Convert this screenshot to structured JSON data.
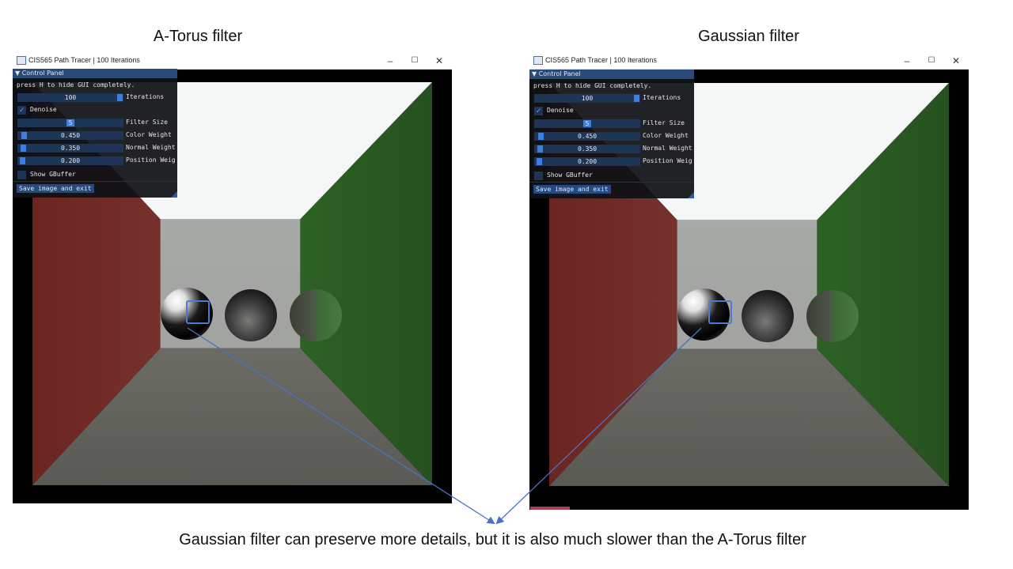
{
  "headings": {
    "left": "A-Torus filter",
    "right": "Gaussian filter"
  },
  "caption": "Gaussian filter can preserve more details, but it is also much slower than the A-Torus filter",
  "window": {
    "title": "CIS565 Path Tracer | 100 Iterations",
    "minimize_icon": "–",
    "maximize_icon": "☐",
    "close_icon": "✕"
  },
  "panel": {
    "header": "▼ Control Panel",
    "hint": "press H to hide GUI completely.",
    "iterations": {
      "value": "100",
      "label": "Iterations",
      "level": 1.0
    },
    "denoise": {
      "label": "Denoise",
      "checked": true,
      "check_glyph": "✓"
    },
    "filter_size": {
      "value": "5",
      "label": "Filter Size"
    },
    "color_weight": {
      "value": "0.450",
      "label": "Color Weight"
    },
    "normal_weight": {
      "value": "0.350",
      "label": "Normal Weight"
    },
    "position_weight": {
      "value": "0.200",
      "label": "Position Weig"
    },
    "show_gbuffer": {
      "label": "Show GBuffer",
      "checked": false
    },
    "save_button": "Save image and exit"
  },
  "colors": {
    "accent": "#3d7fe0",
    "panel_header": "#2a4a7a",
    "arrow": "#4a72c4"
  }
}
